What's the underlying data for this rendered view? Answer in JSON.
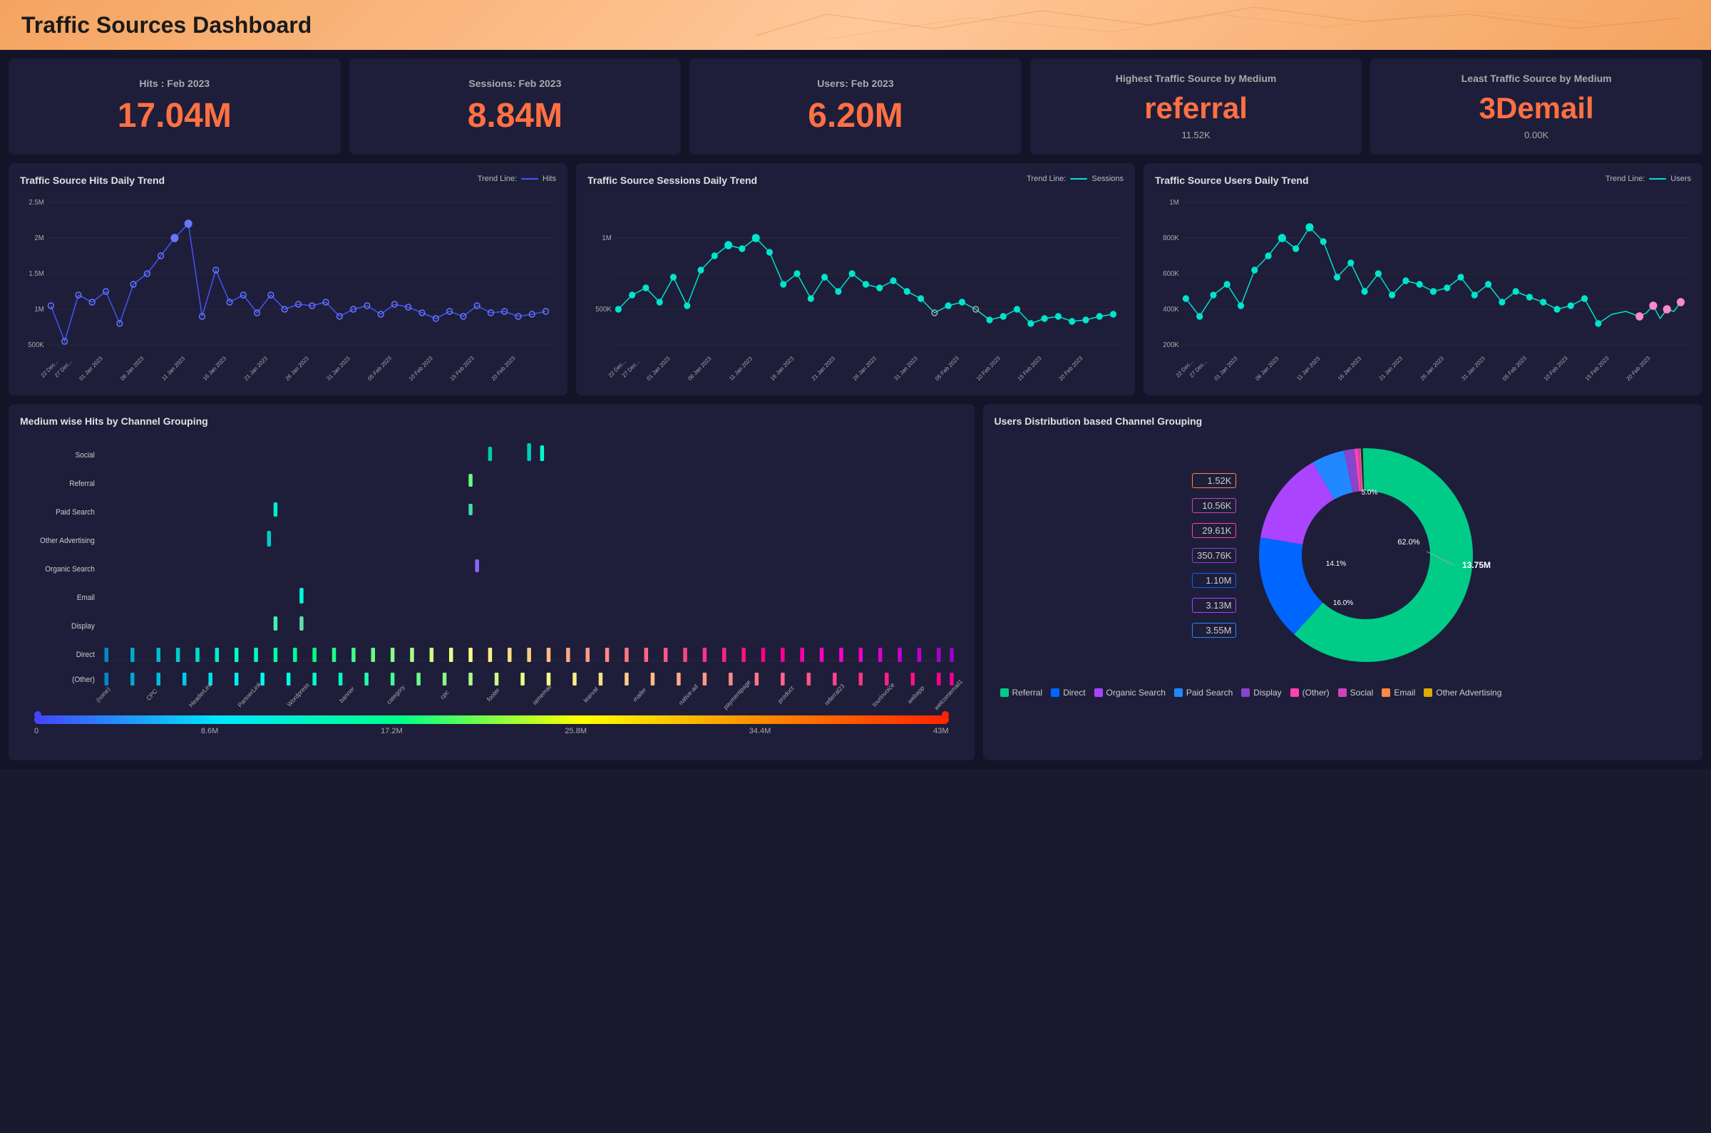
{
  "header": {
    "title": "Traffic Sources Dashboard"
  },
  "kpis": [
    {
      "label": "Hits : Feb 2023",
      "value": "17.04M",
      "sub": null
    },
    {
      "label": "Sessions: Feb 2023",
      "value": "8.84M",
      "sub": null
    },
    {
      "label": "Users: Feb 2023",
      "value": "6.20M",
      "sub": null
    },
    {
      "label": "Highest Traffic Source by Medium",
      "value": "referral",
      "sub": "11.52K"
    },
    {
      "label": "Least Traffic Source by Medium",
      "value": "3Demail",
      "sub": "0.00K"
    }
  ],
  "charts": {
    "hits": {
      "title": "Traffic Source Hits Daily Trend",
      "legend": "Hits",
      "color": "#4455ff"
    },
    "sessions": {
      "title": "Traffic Source Sessions Daily Trend",
      "legend": "Sessions",
      "color": "#00e5cc"
    },
    "users": {
      "title": "Traffic Source Users Daily Trend",
      "legend": "Users",
      "color": "#00e5cc"
    }
  },
  "bottom_left": {
    "title": "Medium wise Hits by Channel Grouping",
    "categories": [
      "Social",
      "Referral",
      "Paid Search",
      "Other Advertising",
      "Organic Search",
      "Email",
      "Display",
      "Direct",
      "(Other)"
    ],
    "x_labels": [
      "(none)",
      "CPC",
      "HeaderLink",
      "PartnerLink",
      "Wordpress",
      "banner",
      "category",
      "cpc",
      "footer",
      "iamemail",
      "learvat",
      "mailer",
      "native-ad",
      "paymentpage",
      "product",
      "referral23",
      "tourinvoice",
      "webapp",
      "welcomemail1"
    ],
    "colorbar_labels": [
      "0",
      "8.6M",
      "17.2M",
      "25.8M",
      "34.4M",
      "43M"
    ]
  },
  "bottom_right": {
    "title": "Users Distribution based Channel Grouping",
    "donut_data": [
      {
        "label": "Referral",
        "value": "13.75M",
        "pct": 62.0,
        "color": "#00cc88"
      },
      {
        "label": "Direct",
        "value": "3.55M",
        "pct": 16.0,
        "color": "#0066ff"
      },
      {
        "label": "Organic Search",
        "value": "3.13M",
        "pct": 14.1,
        "color": "#aa44ff"
      },
      {
        "label": "Paid Search",
        "value": "1.10M",
        "pct": 5.0,
        "color": "#2288ff"
      },
      {
        "label": "Display",
        "value": "350.76K",
        "pct": 1.6,
        "color": "#8844cc"
      },
      {
        "label": "(Other)",
        "value": "29.61K",
        "pct": 0.5,
        "color": "#ff44aa"
      },
      {
        "label": "Social",
        "value": "10.56K",
        "pct": 0.3,
        "color": "#cc44bb"
      },
      {
        "label": "Email",
        "value": "1.52K",
        "pct": 0.1,
        "color": "#ff8844"
      },
      {
        "label": "Other Advertising",
        "value": "",
        "pct": 0.05,
        "color": "#ddaa00"
      }
    ],
    "left_labels": [
      "1.52K",
      "10.56K",
      "29.61K",
      "350.76K",
      "1.10M",
      "3.13M",
      "3.55M"
    ],
    "right_labels": [
      "13.75M"
    ]
  },
  "legend_items": [
    {
      "label": "Referral",
      "color": "#00cc88"
    },
    {
      "label": "Direct",
      "color": "#0066ff"
    },
    {
      "label": "Organic Search",
      "color": "#aa44ff"
    },
    {
      "label": "Paid Search",
      "color": "#2288ff"
    },
    {
      "label": "Display",
      "color": "#8844cc"
    },
    {
      "label": "(Other)",
      "color": "#ff44aa"
    },
    {
      "label": "Social",
      "color": "#cc44bb"
    },
    {
      "label": "Email",
      "color": "#ff8844"
    },
    {
      "label": "Other Advertising",
      "color": "#ddaa00"
    }
  ]
}
